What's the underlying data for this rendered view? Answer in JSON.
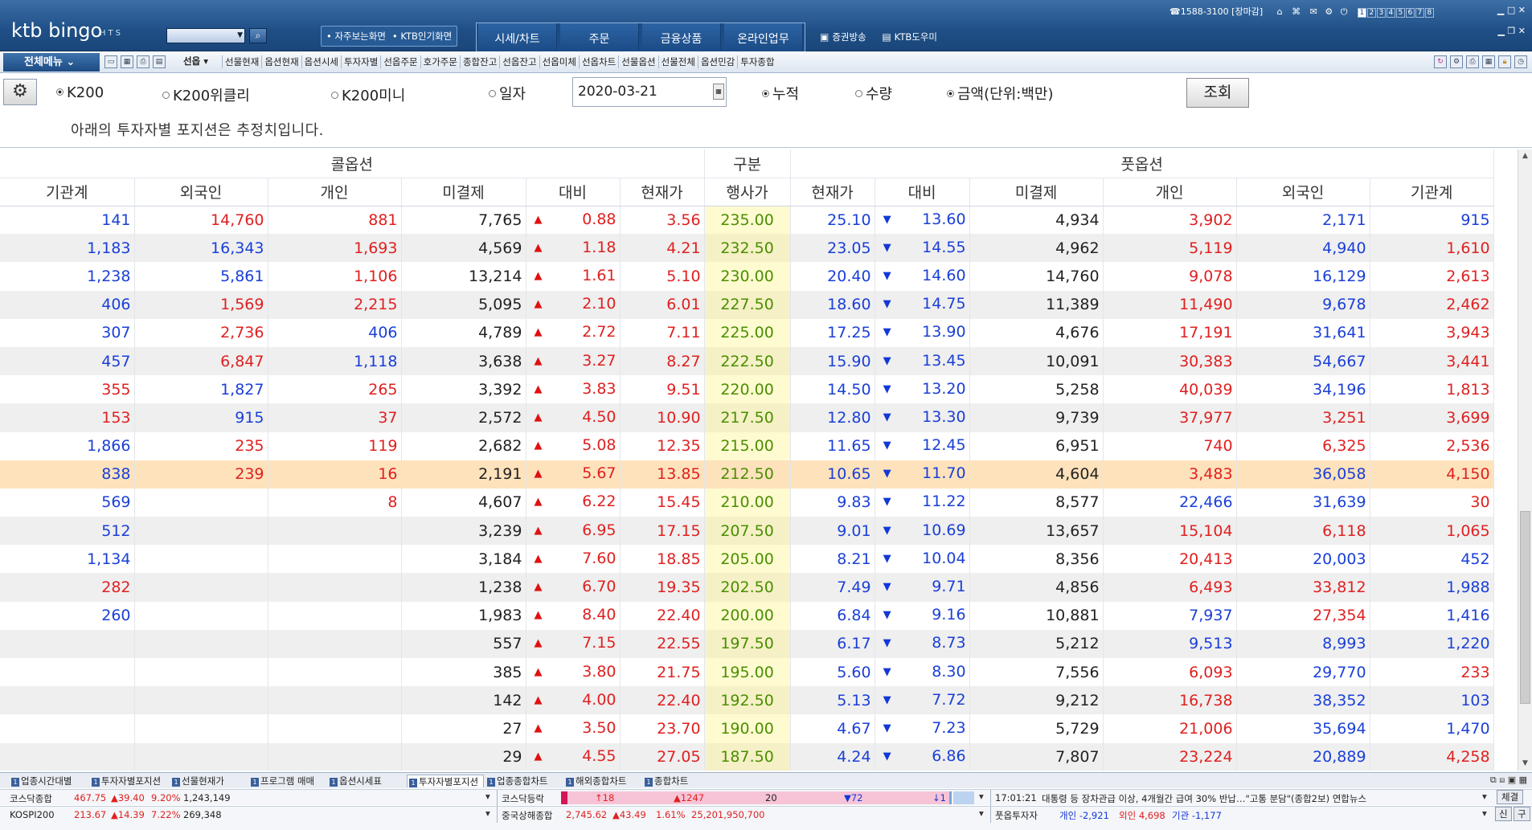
{
  "header": {
    "logo": "ktb bingo",
    "logo_sub": "HTS",
    "quick": [
      "• 자주보는화면",
      "• KTB인기화면"
    ],
    "main_tabs": [
      "시세/차트",
      "주문",
      "금융상품",
      "온라인업무"
    ],
    "links": [
      "증권방송",
      "KTB도우미"
    ],
    "phone": "☎1588-3100",
    "market_status": "[장마감]",
    "screen_numbers": [
      "1",
      "2",
      "3",
      "4",
      "5",
      "6",
      "7",
      "8"
    ]
  },
  "menubar": {
    "all_menu": "전체메뉴",
    "screen_select": "선옵",
    "quick_links": [
      "선물현재",
      "옵션현재",
      "옵션시세",
      "투자자별",
      "선옵주문",
      "호가주문",
      "종합잔고",
      "선옵잔고",
      "선옵미체",
      "선옵차트",
      "선물옵션",
      "선물전체",
      "옵션민감",
      "투자종합"
    ]
  },
  "filters": {
    "radios_a": [
      {
        "label": "K200",
        "selected": true
      },
      {
        "label": "K200위클리",
        "selected": false
      },
      {
        "label": "K200미니",
        "selected": false
      },
      {
        "label": "일자",
        "selected": false
      }
    ],
    "date": "2020-03-21",
    "radios_b": [
      {
        "label": "누적",
        "selected": true
      },
      {
        "label": "수량",
        "selected": false
      },
      {
        "label": "금액(단위:백만)",
        "selected": true
      }
    ],
    "query_button": "조회",
    "notice": "아래의 투자자별 포지션은 추정치입니다."
  },
  "table": {
    "group_headers": [
      "콜옵션",
      "구분",
      "풋옵션"
    ],
    "columns": [
      "기관계",
      "외국인",
      "개인",
      "미결제",
      "대비",
      "현재가",
      "행사가",
      "현재가",
      "대비",
      "미결제",
      "개인",
      "외국인",
      "기관계"
    ],
    "rows": [
      [
        "141",
        "14,760",
        "881",
        "7,765",
        "0.88",
        "3.56",
        "235.00",
        "25.10",
        "13.60",
        "4,934",
        "3,902",
        "2,171",
        "915"
      ],
      [
        "1,183",
        "16,343",
        "1,693",
        "4,569",
        "1.18",
        "4.21",
        "232.50",
        "23.05",
        "14.55",
        "4,962",
        "5,119",
        "4,940",
        "1,610"
      ],
      [
        "1,238",
        "5,861",
        "1,106",
        "13,214",
        "1.61",
        "5.10",
        "230.00",
        "20.40",
        "14.60",
        "14,760",
        "9,078",
        "16,129",
        "2,613"
      ],
      [
        "406",
        "1,569",
        "2,215",
        "5,095",
        "2.10",
        "6.01",
        "227.50",
        "18.60",
        "14.75",
        "11,389",
        "11,490",
        "9,678",
        "2,462"
      ],
      [
        "307",
        "2,736",
        "406",
        "4,789",
        "2.72",
        "7.11",
        "225.00",
        "17.25",
        "13.90",
        "4,676",
        "17,191",
        "31,641",
        "3,943"
      ],
      [
        "457",
        "6,847",
        "1,118",
        "3,638",
        "3.27",
        "8.27",
        "222.50",
        "15.90",
        "13.45",
        "10,091",
        "30,383",
        "54,667",
        "3,441"
      ],
      [
        "355",
        "1,827",
        "265",
        "3,392",
        "3.83",
        "9.51",
        "220.00",
        "14.50",
        "13.20",
        "5,258",
        "40,039",
        "34,196",
        "1,813"
      ],
      [
        "153",
        "915",
        "37",
        "2,572",
        "4.50",
        "10.90",
        "217.50",
        "12.80",
        "13.30",
        "9,739",
        "37,977",
        "3,251",
        "3,699"
      ],
      [
        "1,866",
        "235",
        "119",
        "2,682",
        "5.08",
        "12.35",
        "215.00",
        "11.65",
        "12.45",
        "6,951",
        "740",
        "6,325",
        "2,536"
      ],
      [
        "838",
        "239",
        "16",
        "2,191",
        "5.67",
        "13.85",
        "212.50",
        "10.65",
        "11.70",
        "4,604",
        "3,483",
        "36,058",
        "4,150"
      ],
      [
        "569",
        "",
        "8",
        "4,607",
        "6.22",
        "15.45",
        "210.00",
        "9.83",
        "11.22",
        "8,577",
        "22,466",
        "31,639",
        "30"
      ],
      [
        "512",
        "",
        "",
        "3,239",
        "6.95",
        "17.15",
        "207.50",
        "9.01",
        "10.69",
        "13,657",
        "15,104",
        "6,118",
        "1,065"
      ],
      [
        "1,134",
        "",
        "",
        "3,184",
        "7.60",
        "18.85",
        "205.00",
        "8.21",
        "10.04",
        "8,356",
        "20,413",
        "20,003",
        "452"
      ],
      [
        "282",
        "",
        "",
        "1,238",
        "6.70",
        "19.35",
        "202.50",
        "7.49",
        "9.71",
        "4,856",
        "6,493",
        "33,812",
        "1,988"
      ],
      [
        "260",
        "",
        "",
        "1,983",
        "8.40",
        "22.40",
        "200.00",
        "6.84",
        "9.16",
        "10,881",
        "7,937",
        "27,354",
        "1,416"
      ],
      [
        "",
        "",
        "",
        "557",
        "7.15",
        "22.55",
        "197.50",
        "6.17",
        "8.73",
        "5,212",
        "9,513",
        "8,993",
        "1,220"
      ],
      [
        "",
        "",
        "",
        "385",
        "3.80",
        "21.75",
        "195.00",
        "5.60",
        "8.30",
        "7,556",
        "6,093",
        "29,770",
        "233"
      ],
      [
        "",
        "",
        "",
        "142",
        "4.00",
        "22.40",
        "192.50",
        "5.13",
        "7.72",
        "9,212",
        "16,738",
        "38,352",
        "103"
      ],
      [
        "",
        "",
        "",
        "27",
        "3.50",
        "23.70",
        "190.00",
        "4.67",
        "7.23",
        "5,729",
        "21,006",
        "35,694",
        "1,470"
      ],
      [
        "",
        "",
        "",
        "29",
        "4.55",
        "27.05",
        "187.50",
        "4.24",
        "6.86",
        "7,807",
        "23,224",
        "20,889",
        "4,258"
      ]
    ],
    "highlight_row": 9,
    "colors": {
      "row0": [
        "b",
        "r",
        "r"
      ],
      "row1": [
        "b",
        "b",
        "r"
      ],
      "row2": [
        "b",
        "b",
        "r"
      ],
      "row3": [
        "b",
        "r",
        "r"
      ],
      "row4": [
        "b",
        "r",
        "b"
      ],
      "row5": [
        "b",
        "r",
        "b"
      ],
      "row6": [
        "r",
        "b",
        "r"
      ],
      "row7": [
        "r",
        "b",
        "r"
      ],
      "row8": [
        "b",
        "r",
        "r"
      ],
      "row9": [
        "b",
        "r",
        "r"
      ],
      "row10": [
        "b",
        "",
        "r"
      ],
      "row11": [
        "b",
        "",
        ""
      ],
      "row12": [
        "b",
        "",
        ""
      ],
      "row13": [
        "r",
        "",
        ""
      ],
      "row14": [
        "b",
        "",
        ""
      ],
      "row15": [
        "",
        "",
        ""
      ],
      "row16": [
        "",
        "",
        ""
      ],
      "row17": [
        "",
        "",
        ""
      ],
      "row18": [
        "",
        "",
        ""
      ],
      "row19": [
        "",
        "",
        ""
      ],
      "put0": [
        "r",
        "b",
        "b"
      ],
      "put1": [
        "r",
        "b",
        "r"
      ],
      "put2": [
        "r",
        "b",
        "r"
      ],
      "put3": [
        "r",
        "b",
        "r"
      ],
      "put4": [
        "r",
        "b",
        "r"
      ],
      "put5": [
        "r",
        "b",
        "r"
      ],
      "put6": [
        "r",
        "b",
        "r"
      ],
      "put7": [
        "r",
        "r",
        "r"
      ],
      "put8": [
        "r",
        "r",
        "r"
      ],
      "put9": [
        "r",
        "b",
        "r"
      ],
      "put10": [
        "b",
        "b",
        "r"
      ],
      "put11": [
        "r",
        "r",
        "r"
      ],
      "put12": [
        "r",
        "b",
        "b"
      ],
      "put13": [
        "r",
        "r",
        "b"
      ],
      "put14": [
        "b",
        "r",
        "b"
      ],
      "put15": [
        "b",
        "b",
        "b"
      ],
      "put16": [
        "r",
        "b",
        "r"
      ],
      "put17": [
        "r",
        "b",
        "b"
      ],
      "put18": [
        "r",
        "b",
        "b"
      ],
      "put19": [
        "r",
        "b",
        "r"
      ]
    }
  },
  "taskbar": {
    "tabs": [
      "업종시간대별",
      "투자자별포지션",
      "선물현재가",
      "프로그램 매매",
      "옵션시세표",
      "투자자별포지션",
      "업종종합차트",
      "해외종합차트",
      "종합차트"
    ],
    "active_tab": 5
  },
  "ticker1": {
    "kosdaq_label": "코스닥종합",
    "kosdaq_value": "467.75",
    "kosdaq_change": "▲39.40",
    "kosdaq_pct": "9.20%",
    "kosdaq_vol": "1,243,149",
    "advdec_label": "코스닥등락",
    "adv_limit": "↑18",
    "adv": "▲1247",
    "flat": "20",
    "dec": "▼72",
    "dec_limit": "↓1",
    "news_time": "17:01:21",
    "news": "대통령 등 장차관급 이상, 4개월간 급여 30% 반납…\"고통 분담\"(종합2보)  연합뉴스",
    "settle_btn": "체결"
  },
  "ticker2": {
    "k200_label": "KOSPI200",
    "k200_value": "213.67",
    "k200_change": "▲14.39",
    "k200_pct": "7.22%",
    "k200_vol": "269,348",
    "china_label": "중국상해종합",
    "china_value": "2,745.62",
    "china_change": "▲43.49",
    "china_pct": "1.61%",
    "china_vol": "25,201,950,700",
    "investor_label": "풋옵투자자",
    "indiv": "개인 -2,921",
    "foreign": "외인 4,698",
    "inst": "기관 -1,177",
    "btn_new": "신",
    "btn_old": "구"
  }
}
